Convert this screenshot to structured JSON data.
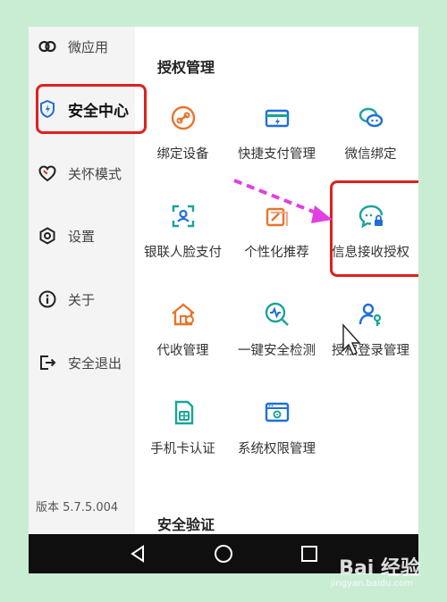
{
  "sidebar": {
    "items": [
      {
        "label": "微应用",
        "icon": "link-rings-icon"
      },
      {
        "label": "安全中心",
        "icon": "shield-icon",
        "active": true
      },
      {
        "label": "关怀模式",
        "icon": "heart-icon"
      },
      {
        "label": "设置",
        "icon": "hexagon-gear-icon"
      },
      {
        "label": "关于",
        "icon": "info-icon"
      },
      {
        "label": "安全退出",
        "icon": "exit-icon"
      }
    ],
    "version": "版本 5.7.5.004"
  },
  "main": {
    "section_auth": "授权管理",
    "items": [
      {
        "label": "绑定设备",
        "icon": "device-link-icon"
      },
      {
        "label": "快捷支付管理",
        "icon": "quick-pay-card-icon"
      },
      {
        "label": "微信绑定",
        "icon": "wechat-icon"
      },
      {
        "label": "银联人脸支付",
        "icon": "face-scan-icon"
      },
      {
        "label": "个性化推荐",
        "icon": "personalize-icon"
      },
      {
        "label": "信息接收授权",
        "icon": "message-lock-icon"
      },
      {
        "label": "代收管理",
        "icon": "collection-house-icon"
      },
      {
        "label": "一键安全检测",
        "icon": "security-scan-icon"
      },
      {
        "label": "授权登录管理",
        "icon": "user-key-icon"
      },
      {
        "label": "手机卡认证",
        "icon": "sim-card-icon"
      },
      {
        "label": "系统权限管理",
        "icon": "system-settings-icon"
      }
    ],
    "section_verify": "安全验证"
  },
  "watermark": {
    "brand": "Bai  经验",
    "url": "jingyan.baidu.com"
  },
  "colors": {
    "accent_red": "#e02020",
    "icon_blue": "#1f6fd8",
    "icon_teal": "#1aa39a",
    "icon_orange": "#e8742c",
    "arrow_magenta": "#e040e0"
  }
}
